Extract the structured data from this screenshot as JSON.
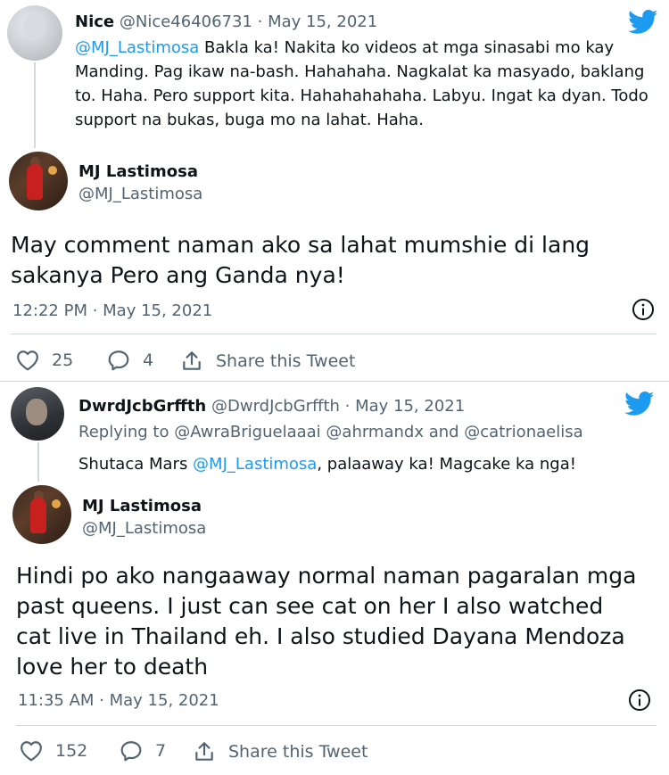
{
  "tweet1": {
    "quoted": {
      "name": "Nice",
      "meta": "@Nice46406731 · May 15, 2021",
      "mention": "@MJ_Lastimosa",
      "text": " Bakla ka! Nakita ko videos at mga sinasabi mo kay Manding. Pag ikaw na-bash. Hahahaha. Nagkalat ka masyado, baklang to. Haha. Pero support kita. Hahahahahaha. Labyu. Ingat ka dyan. Todo support na bukas, buga mo na lahat. Haha."
    },
    "author": {
      "name": "MJ Lastimosa",
      "handle": "@MJ_Lastimosa"
    },
    "text": "May comment naman ako sa lahat mumshie di lang sakanya Pero ang Ganda nya!",
    "timestamp": "12:22 PM · May 15, 2021",
    "likes": "25",
    "replies": "4",
    "share_label": "Share this Tweet"
  },
  "tweet2": {
    "quoted": {
      "name": "DwrdJcbGrffth",
      "meta": "@DwrdJcbGrffth · May 15, 2021",
      "replying_to": "Replying to @AwraBriguelaaai @ahrmandx and @catrionaelisa",
      "text_before": "Shutaca Mars ",
      "mention": "@MJ_Lastimosa",
      "text_after": ", palaaway ka! Magcake ka nga!"
    },
    "author": {
      "name": "MJ Lastimosa",
      "handle": "@MJ_Lastimosa"
    },
    "text": "Hindi po ako nangaaway normal naman pagaralan mga past queens. I just can see cat on her I also watched cat live in Thailand eh. I also studied Dayana Mendoza love her to death",
    "timestamp": "11:35 AM · May 15, 2021",
    "likes": "152",
    "replies": "7",
    "share_label": "Share this Tweet"
  },
  "icons": {
    "brand": "twitter-bird-icon",
    "like": "heart-icon",
    "reply": "speech-bubble-icon",
    "share": "share-arrow-icon",
    "info": "info-icon"
  },
  "colors": {
    "brand": "#1d9bf0",
    "muted": "#536471",
    "text": "#0f1419",
    "border": "#cfd9de"
  }
}
